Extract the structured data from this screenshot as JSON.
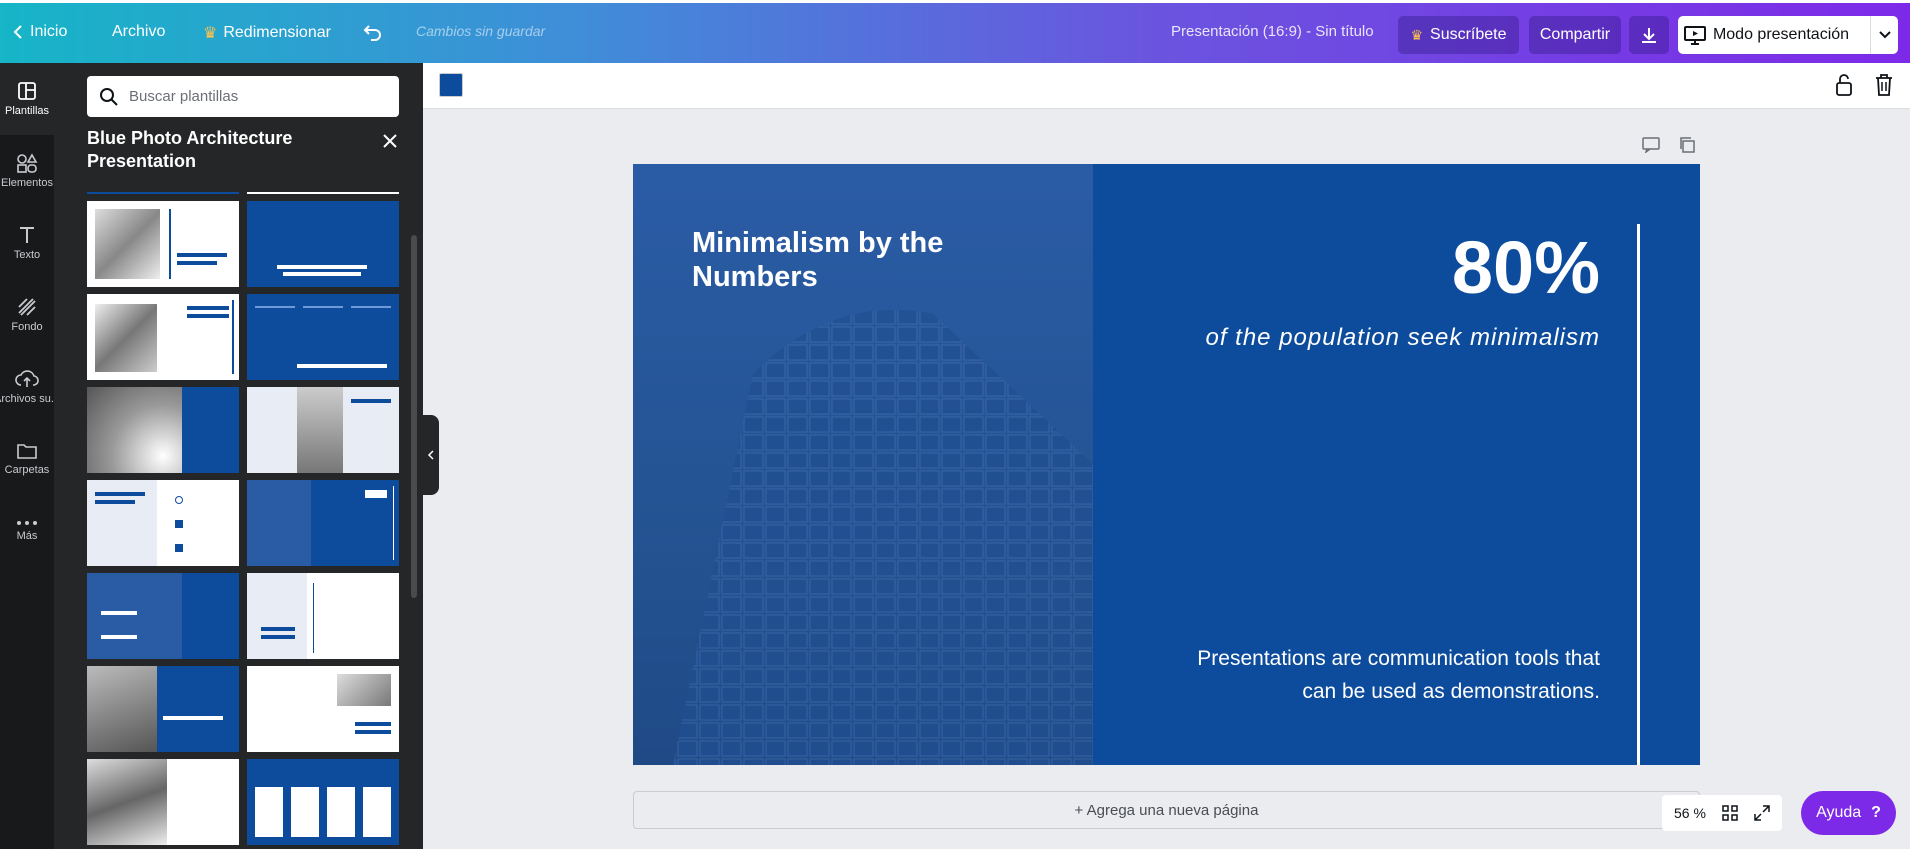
{
  "topbar": {
    "home": "Inicio",
    "file": "Archivo",
    "resize": "Redimensionar",
    "unsaved": "Cambios sin guardar",
    "doc_title": "Presentación (16:9) - Sin título",
    "subscribe": "Suscríbete",
    "share": "Compartir",
    "present": "Modo presentación"
  },
  "rail": [
    {
      "label": "Plantillas",
      "icon": "templates-icon"
    },
    {
      "label": "Elementos",
      "icon": "elements-icon"
    },
    {
      "label": "Texto",
      "icon": "text-icon"
    },
    {
      "label": "Fondo",
      "icon": "background-icon"
    },
    {
      "label": "Archivos su...",
      "icon": "upload-icon"
    },
    {
      "label": "Carpetas",
      "icon": "folder-icon"
    },
    {
      "label": "Más",
      "icon": "more-icon"
    }
  ],
  "panel": {
    "search_placeholder": "Buscar plantillas",
    "title": "Blue Photo Architecture Presentation"
  },
  "slide": {
    "title": "Minimalism by the Numbers",
    "big_number": "80%",
    "subtitle": "of the population seek minimalism",
    "body": "Presentations are communication tools that can be used as demonstrations.",
    "accent_color": "#0d4c9c"
  },
  "footer": {
    "add_page": "+ Agrega una nueva página",
    "zoom": "56 %",
    "help": "Ayuda",
    "help_symbol": "?"
  }
}
